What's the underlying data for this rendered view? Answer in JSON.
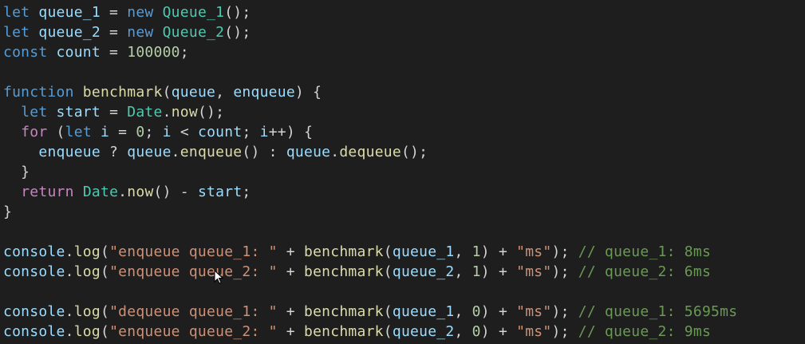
{
  "code_lines": [
    [
      {
        "t": "let",
        "c": "kw"
      },
      {
        "t": " ",
        "c": "op"
      },
      {
        "t": "queue_1",
        "c": "var"
      },
      {
        "t": " = ",
        "c": "op"
      },
      {
        "t": "new",
        "c": "kw"
      },
      {
        "t": " ",
        "c": "op"
      },
      {
        "t": "Queue_1",
        "c": "cls"
      },
      {
        "t": "();",
        "c": "op"
      }
    ],
    [
      {
        "t": "let",
        "c": "kw"
      },
      {
        "t": " ",
        "c": "op"
      },
      {
        "t": "queue_2",
        "c": "var"
      },
      {
        "t": " = ",
        "c": "op"
      },
      {
        "t": "new",
        "c": "kw"
      },
      {
        "t": " ",
        "c": "op"
      },
      {
        "t": "Queue_2",
        "c": "cls"
      },
      {
        "t": "();",
        "c": "op"
      }
    ],
    [
      {
        "t": "const",
        "c": "kw"
      },
      {
        "t": " ",
        "c": "op"
      },
      {
        "t": "count",
        "c": "var"
      },
      {
        "t": " = ",
        "c": "op"
      },
      {
        "t": "100000",
        "c": "num"
      },
      {
        "t": ";",
        "c": "op"
      }
    ],
    [],
    [
      {
        "t": "function",
        "c": "kw"
      },
      {
        "t": " ",
        "c": "op"
      },
      {
        "t": "benchmark",
        "c": "fn"
      },
      {
        "t": "(",
        "c": "op"
      },
      {
        "t": "queue",
        "c": "var"
      },
      {
        "t": ", ",
        "c": "op"
      },
      {
        "t": "enqueue",
        "c": "var"
      },
      {
        "t": ") {",
        "c": "op"
      }
    ],
    [
      {
        "t": "  ",
        "c": "op"
      },
      {
        "t": "let",
        "c": "kw"
      },
      {
        "t": " ",
        "c": "op"
      },
      {
        "t": "start",
        "c": "var"
      },
      {
        "t": " = ",
        "c": "op"
      },
      {
        "t": "Date",
        "c": "cls"
      },
      {
        "t": ".",
        "c": "op"
      },
      {
        "t": "now",
        "c": "fn"
      },
      {
        "t": "();",
        "c": "op"
      }
    ],
    [
      {
        "t": "  ",
        "c": "op"
      },
      {
        "t": "for",
        "c": "ctl"
      },
      {
        "t": " (",
        "c": "op"
      },
      {
        "t": "let",
        "c": "kw"
      },
      {
        "t": " ",
        "c": "op"
      },
      {
        "t": "i",
        "c": "var"
      },
      {
        "t": " = ",
        "c": "op"
      },
      {
        "t": "0",
        "c": "num"
      },
      {
        "t": "; ",
        "c": "op"
      },
      {
        "t": "i",
        "c": "var"
      },
      {
        "t": " < ",
        "c": "op"
      },
      {
        "t": "count",
        "c": "var"
      },
      {
        "t": "; ",
        "c": "op"
      },
      {
        "t": "i",
        "c": "var"
      },
      {
        "t": "++) {",
        "c": "op"
      }
    ],
    [
      {
        "t": "    ",
        "c": "op"
      },
      {
        "t": "enqueue",
        "c": "var"
      },
      {
        "t": " ? ",
        "c": "op"
      },
      {
        "t": "queue",
        "c": "var"
      },
      {
        "t": ".",
        "c": "op"
      },
      {
        "t": "enqueue",
        "c": "fn"
      },
      {
        "t": "() : ",
        "c": "op"
      },
      {
        "t": "queue",
        "c": "var"
      },
      {
        "t": ".",
        "c": "op"
      },
      {
        "t": "dequeue",
        "c": "fn"
      },
      {
        "t": "();",
        "c": "op"
      }
    ],
    [
      {
        "t": "  }",
        "c": "op"
      }
    ],
    [
      {
        "t": "  ",
        "c": "op"
      },
      {
        "t": "return",
        "c": "ctl"
      },
      {
        "t": " ",
        "c": "op"
      },
      {
        "t": "Date",
        "c": "cls"
      },
      {
        "t": ".",
        "c": "op"
      },
      {
        "t": "now",
        "c": "fn"
      },
      {
        "t": "() - ",
        "c": "op"
      },
      {
        "t": "start",
        "c": "var"
      },
      {
        "t": ";",
        "c": "op"
      }
    ],
    [
      {
        "t": "}",
        "c": "op"
      }
    ],
    [],
    [
      {
        "t": "console",
        "c": "var"
      },
      {
        "t": ".",
        "c": "op"
      },
      {
        "t": "log",
        "c": "fn"
      },
      {
        "t": "(",
        "c": "op"
      },
      {
        "t": "\"enqueue queue_1: \"",
        "c": "str"
      },
      {
        "t": " + ",
        "c": "op"
      },
      {
        "t": "benchmark",
        "c": "fn"
      },
      {
        "t": "(",
        "c": "op"
      },
      {
        "t": "queue_1",
        "c": "var"
      },
      {
        "t": ", ",
        "c": "op"
      },
      {
        "t": "1",
        "c": "num"
      },
      {
        "t": ") + ",
        "c": "op"
      },
      {
        "t": "\"ms\"",
        "c": "str"
      },
      {
        "t": "); ",
        "c": "op"
      },
      {
        "t": "// queue_1: 8ms",
        "c": "cmt"
      }
    ],
    [
      {
        "t": "console",
        "c": "var"
      },
      {
        "t": ".",
        "c": "op"
      },
      {
        "t": "log",
        "c": "fn"
      },
      {
        "t": "(",
        "c": "op"
      },
      {
        "t": "\"enqueue queue_2: \"",
        "c": "str"
      },
      {
        "t": " + ",
        "c": "op"
      },
      {
        "t": "benchmark",
        "c": "fn"
      },
      {
        "t": "(",
        "c": "op"
      },
      {
        "t": "queue_2",
        "c": "var"
      },
      {
        "t": ", ",
        "c": "op"
      },
      {
        "t": "1",
        "c": "num"
      },
      {
        "t": ") + ",
        "c": "op"
      },
      {
        "t": "\"ms\"",
        "c": "str"
      },
      {
        "t": "); ",
        "c": "op"
      },
      {
        "t": "// queue_2: 6ms",
        "c": "cmt"
      }
    ],
    [],
    [
      {
        "t": "console",
        "c": "var"
      },
      {
        "t": ".",
        "c": "op"
      },
      {
        "t": "log",
        "c": "fn"
      },
      {
        "t": "(",
        "c": "op"
      },
      {
        "t": "\"dequeue queue_1: \"",
        "c": "str"
      },
      {
        "t": " + ",
        "c": "op"
      },
      {
        "t": "benchmark",
        "c": "fn"
      },
      {
        "t": "(",
        "c": "op"
      },
      {
        "t": "queue_1",
        "c": "var"
      },
      {
        "t": ", ",
        "c": "op"
      },
      {
        "t": "0",
        "c": "num"
      },
      {
        "t": ") + ",
        "c": "op"
      },
      {
        "t": "\"ms\"",
        "c": "str"
      },
      {
        "t": "); ",
        "c": "op"
      },
      {
        "t": "// queue_1: 5695ms",
        "c": "cmt"
      }
    ],
    [
      {
        "t": "console",
        "c": "var"
      },
      {
        "t": ".",
        "c": "op"
      },
      {
        "t": "log",
        "c": "fn"
      },
      {
        "t": "(",
        "c": "op"
      },
      {
        "t": "\"enqueue queue_2: \"",
        "c": "str"
      },
      {
        "t": " + ",
        "c": "op"
      },
      {
        "t": "benchmark",
        "c": "fn"
      },
      {
        "t": "(",
        "c": "op"
      },
      {
        "t": "queue_2",
        "c": "var"
      },
      {
        "t": ", ",
        "c": "op"
      },
      {
        "t": "0",
        "c": "num"
      },
      {
        "t": ") + ",
        "c": "op"
      },
      {
        "t": "\"ms\"",
        "c": "str"
      },
      {
        "t": "); ",
        "c": "op"
      },
      {
        "t": "// queue_2: 9ms",
        "c": "cmt"
      }
    ]
  ],
  "cursor_icon": "mouse-pointer-icon",
  "theme": {
    "background": "#1e1e1e",
    "keyword": "#569cd6",
    "control": "#c586c0",
    "variable": "#9cdcfe",
    "class": "#4ec9b0",
    "function": "#dcdcaa",
    "number": "#b5cea8",
    "string": "#ce9178",
    "comment": "#6a9955",
    "default": "#d4d4d4"
  }
}
